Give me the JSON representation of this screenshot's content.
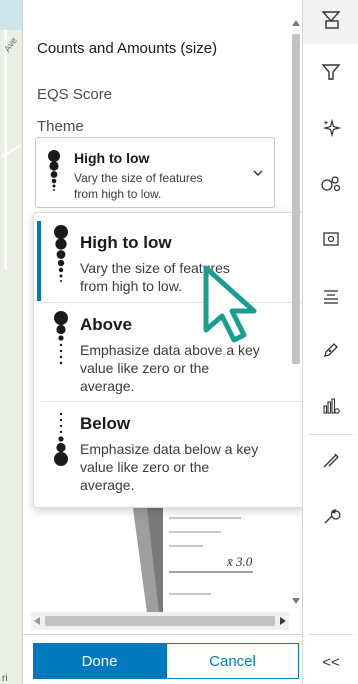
{
  "panel": {
    "title": "Counts and Amounts (size)",
    "field_name": "EQS Score",
    "theme_label": "Theme",
    "selected": {
      "title": "High to low",
      "description": "Vary the size of features from high to low."
    }
  },
  "dropdown": {
    "options": [
      {
        "title": "High to low",
        "description": "Vary the size of features from high to low.",
        "selected": true
      },
      {
        "title": "Above",
        "description": "Emphasize data above a key value like zero or the average.",
        "selected": false
      },
      {
        "title": "Below",
        "description": "Emphasize data below a key value like zero or the average.",
        "selected": false
      }
    ]
  },
  "histogram": {
    "mean_label": "x̄ 3.0"
  },
  "footer": {
    "done_label": "Done",
    "cancel_label": "Cancel"
  },
  "map": {
    "attribution": "ri"
  },
  "toolbar": {
    "collapse_label": "<<",
    "icons": [
      "styles-icon",
      "filter-icon",
      "effects-icon",
      "clustering-icon",
      "popups-icon",
      "labels-icon",
      "edit-icon",
      "charts-icon",
      "sketch-icon",
      "configure-icon"
    ]
  },
  "colors": {
    "accent": "#0079c1",
    "cursor": "#1a9e8f"
  }
}
